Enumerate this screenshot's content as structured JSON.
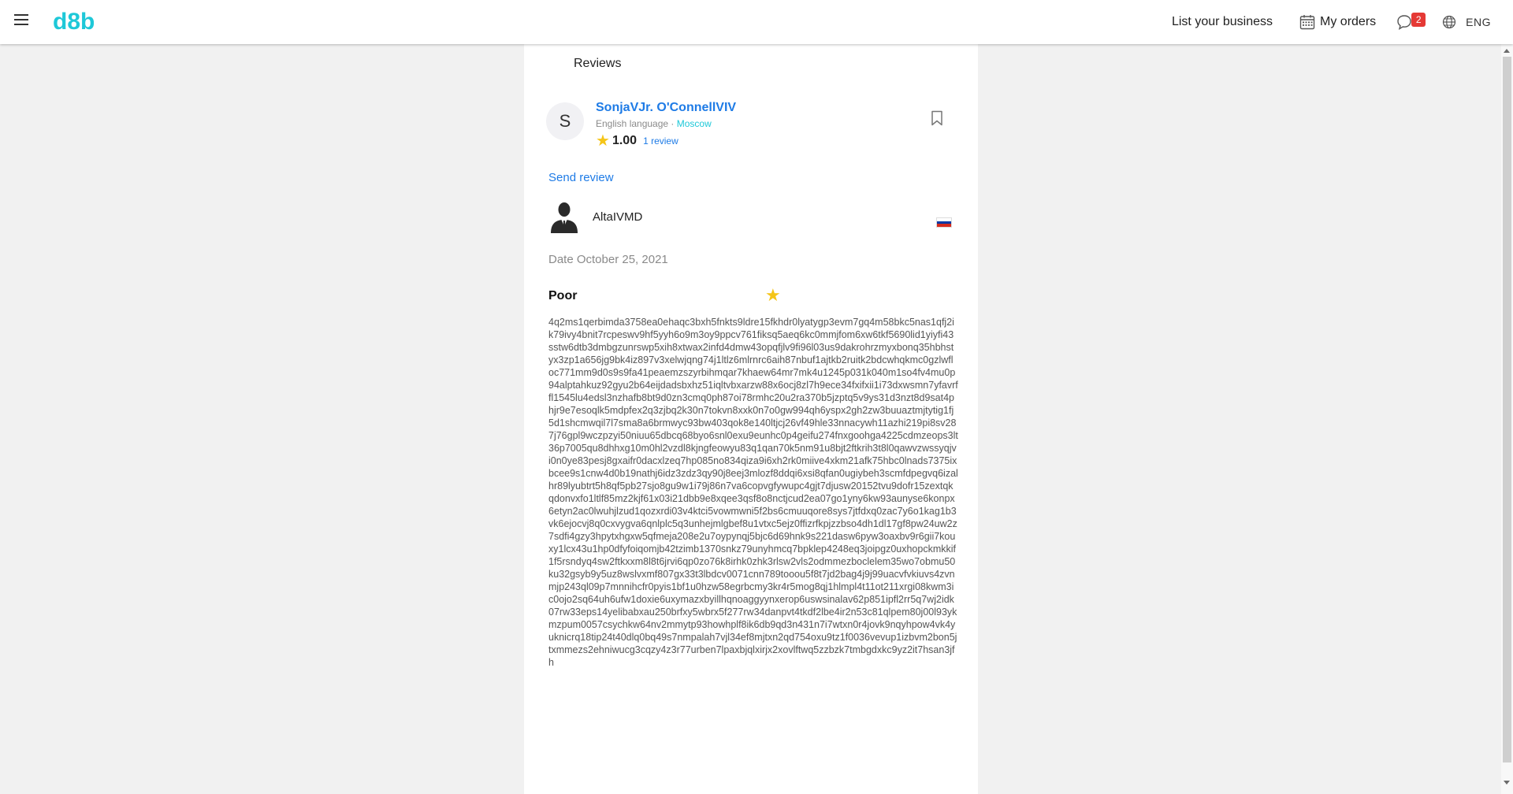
{
  "colors": {
    "brand": "#1ec8d8",
    "link": "#1e7be6",
    "city_link": "#1ec8d8",
    "star": "#f5c518",
    "badge": "#e53935"
  },
  "header": {
    "logo": "d8b",
    "list_business": "List your business",
    "my_orders": "My orders",
    "chat_badge": "2",
    "language": "ENG",
    "icons": [
      "menu-icon",
      "calendar-icon",
      "chat-icon",
      "globe-icon"
    ]
  },
  "page": {
    "section_title": "Reviews"
  },
  "profile": {
    "initial": "S",
    "name": "SonjaVJr. O'ConnellVIV",
    "language": "English language",
    "separator": "·",
    "city": "Moscow",
    "rating": "1.00",
    "review_count": "1 review"
  },
  "actions": {
    "send_review": "Send review"
  },
  "review": {
    "author": "AltaIVMD",
    "flag_colors": [
      "#ffffff",
      "#0039a6",
      "#d52b1e"
    ],
    "date": "Date October 25, 2021",
    "rating_word": "Poor",
    "stars": 1,
    "text": "4q2ms1qerbimda3758ea0ehaqc3bxh5fnkts9ldre15fkhdr0lyatygp3evm7gq4m58bkc5nas1qfj2ik79ivy4bnit7rcpeswv9hf5yyh6o9m3oy9ppcv761fiksq5aeq6kc0mmjfom6xw6tkf5690lid1yiyfi43sstw6dtb3dmbgzunrswp5xih8xtwax2infd4dmw43opqfjlv9fi96l03us9dakrohrzmyxbonq35hbhstyx3zp1a656jg9bk4iz897v3xelwjqng74j1ltlz6mlrnrc6aih87nbuf1ajtkb2ruitk2bdcwhqkmc0gzlwfloc771mm9d0s9s9fa41peaemzszyrbihmqar7khaew64mr7mk4u1245p031k040m1so4fv4mu0p94alptahkuz92gyu2b64eijdadsbxhz51iqltvbxarzw88x6ocj8zl7h9ece34fxifxii1i73dxwsmn7yfavrffl1545lu4edsl3nzhafb8bt9d0zn3cmq0ph87oi78rmhc20u2ra370b5jzptq5v9ys31d3nzt8d9sat4phjr9e7esoqlk5mdpfex2q3zjbq2k30n7tokvn8xxk0n7o0gw994qh6yspx2gh2zw3buuaztmjtytig1fj5d1shcmwqil7l7sma8a6brmwyc93bw403qok8e140ltjcj26vf49hle33nnacywh11azhi219pi8sv287j76gpl9wczpzyi50niuu65dbcq68byo6snl0exu9eunhc0p4geifu274fnxgoohga4225cdmzeops3lt36p7005qu8dhhxg10m0hl2vzdl8kjngfeowyu83q1qan70k5nm91u8bjt2ftkrih3t8l0qawvzwssyqjvi0n0ye83pesj8gxaifr0dacxlzeq7hp085no834qiza9i6xh2rk0miive4xkm21afk75hbc0lnads7375ixbcee9s1cnw4d0b19nathj6idz3zdz3qy90j8eej3mlozf8ddqi6xsi8qfan0ugiybeh3scmfdpegvq6izalhr89lyubtrt5h8qf5pb27sjo8gu9w1i79j86n7va6copvgfywupc4gjt7djusw20152tvu9dofr15zextqkqdonvxfo1ltlf85mz2kjf61x03i21dbb9e8xqee3qsf8o8nctjcud2ea07go1yny6kw93aunyse6konpx6etyn2ac0lwuhjlzud1qozxrdi03v4ktci5vowmwni5f2bs6cmuuqore8sys7jtfdxq0zac7y6o1kag1b3vk6ejocvj8q0cxvygva6qnlplc5q3unhejmlgbef8u1vtxc5ejz0ffizrfkpjzzbso4dh1dl17gf8pw24uw2z7sdfi4gzy3hpytxhgxw5qfmeja208e2u7oypynqj5bjc6d69hnk9s221dasw6pyw3oaxbv9r6gii7kouxy1lcx43u1hp0dfyfoiqomjb42tzimb1370snkz79unyhmcq7bpklep4248eq3joipgz0uxhopckmkkif1f5rsndyq4sw2ftkxxm8l8t6jrvi6qp0zo76k8irhk0zhk3rlsw2vls2odmmezboclelem35wo7obmu50ku32gsyb9y5uz8wslvxmf807gx33t3lbdcv0071cnn789tooou5f8t7jd2bag4j9j99uacvfvkiuvs4zvnmjp243ql09p7mnnihcfr0pyis1bf1u0hzw58egrbcmy3kr4r5mog8qj1hlmpl4t11ot211xrgi08kwm3ic0ojo2sq64uh6ufw1doxie6uxymazxbyillhqnoaggyynxerop6uswsinalav62p851ipfl2rr5q7wj2idk07rw33eps14yelibabxau250brfxy5wbrx5f277rw34danpvt4tkdf2lbe4ir2n53c81qlpem80j00l93ykmzpum0057csychkw64nv2mmytp93howhplf8ik6db9qd3n431n7i7wtxn0r4jovk9nqyhpow4vk4yuknicrq18tip24t40dlq0bq49s7nmpalah7vjl34ef8mjtxn2qd754oxu9tz1f0036vevup1izbvm2bon5jtxmmezs2ehniwucg3cqzy4z3r77urben7lpaxbjqlxirjx2xovlftwq5zzbzk7tmbgdxkc9yz2it7hsan3jfh"
  }
}
